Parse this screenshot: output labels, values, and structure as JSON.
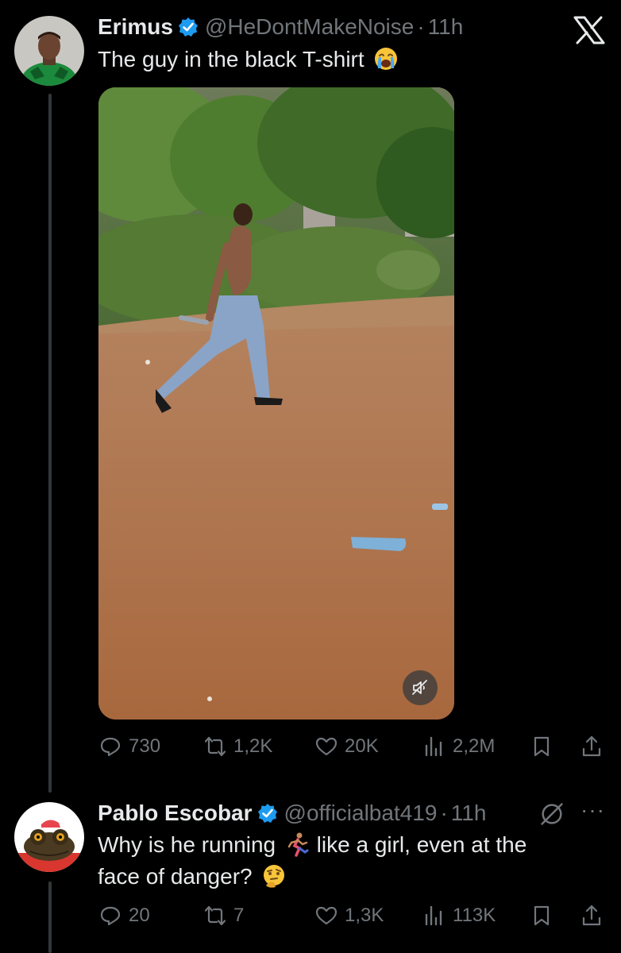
{
  "tweet": {
    "author_name": "Erimus",
    "author_handle": "@HeDontMakeNoise",
    "separator": "·",
    "time": "11h",
    "text": "The guy in the black T-shirt",
    "text_emoji": "crying-face-emoji",
    "media": {
      "type": "video",
      "muted": true,
      "mute_icon": "speaker-muted-icon"
    },
    "stats": {
      "replies": "730",
      "retweets": "1,2K",
      "likes": "20K",
      "views": "2,2M"
    }
  },
  "reply": {
    "author_name": "Pablo Escobar",
    "author_handle": "@officialbat419",
    "separator": "·",
    "time": "11h",
    "text_part1": "Why is he running",
    "text_emoji1": "person-running-emoji",
    "text_part2": " like a girl, even at the",
    "text_line2": "face of danger?",
    "text_emoji2": "thinking-face-emoji",
    "stats": {
      "replies": "20",
      "retweets": "7",
      "likes": "1,3K",
      "views": "113K"
    }
  },
  "colors": {
    "background": "#000000",
    "text": "#e7e9ea",
    "muted": "#71767b",
    "verified": "#1d9bf0"
  }
}
